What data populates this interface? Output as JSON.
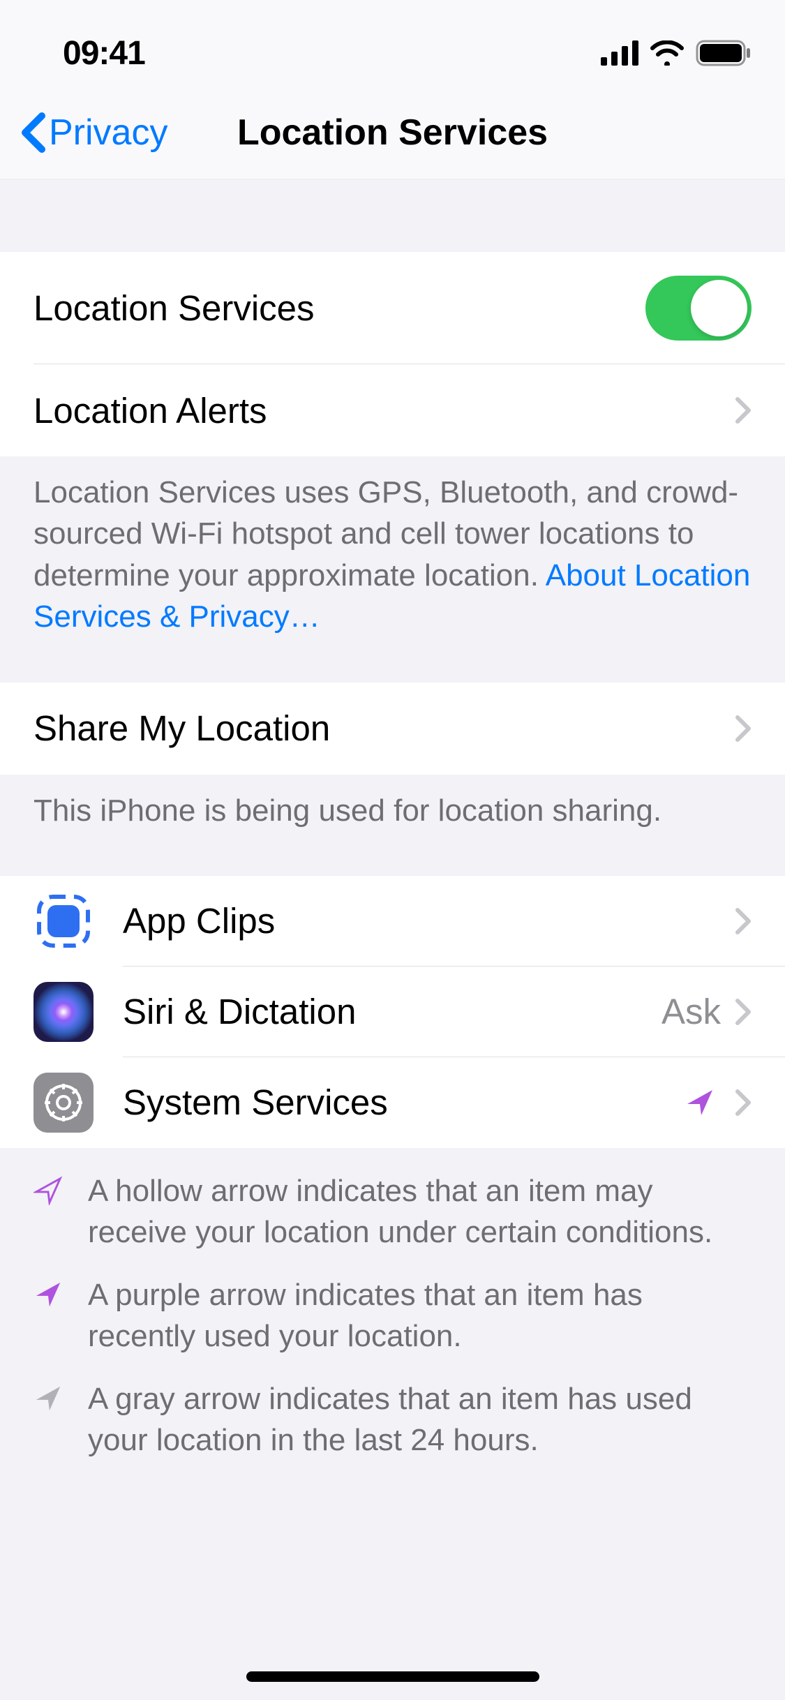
{
  "status_bar": {
    "time": "09:41"
  },
  "nav": {
    "back_label": "Privacy",
    "title": "Location Services"
  },
  "section1": {
    "location_services_label": "Location Services",
    "location_services_on": true,
    "location_alerts_label": "Location Alerts",
    "footer": "Location Services uses GPS, Bluetooth, and crowd-sourced Wi-Fi hotspot and cell tower locations to determine your approximate location. ",
    "footer_link": "About Location Services & Privacy…"
  },
  "section2": {
    "share_my_location_label": "Share My Location",
    "footer": "This iPhone is being used for location sharing."
  },
  "section3": {
    "apps": [
      {
        "name": "App Clips",
        "detail": "",
        "indicator": "none"
      },
      {
        "name": "Siri & Dictation",
        "detail": "Ask",
        "indicator": "none"
      },
      {
        "name": "System Services",
        "detail": "",
        "indicator": "purple"
      }
    ]
  },
  "legend": {
    "hollow": "A hollow arrow indicates that an item may receive your location under certain conditions.",
    "purple": "A purple arrow indicates that an item has recently used your location.",
    "gray": "A gray arrow indicates that an item has used your location in the last 24 hours."
  }
}
